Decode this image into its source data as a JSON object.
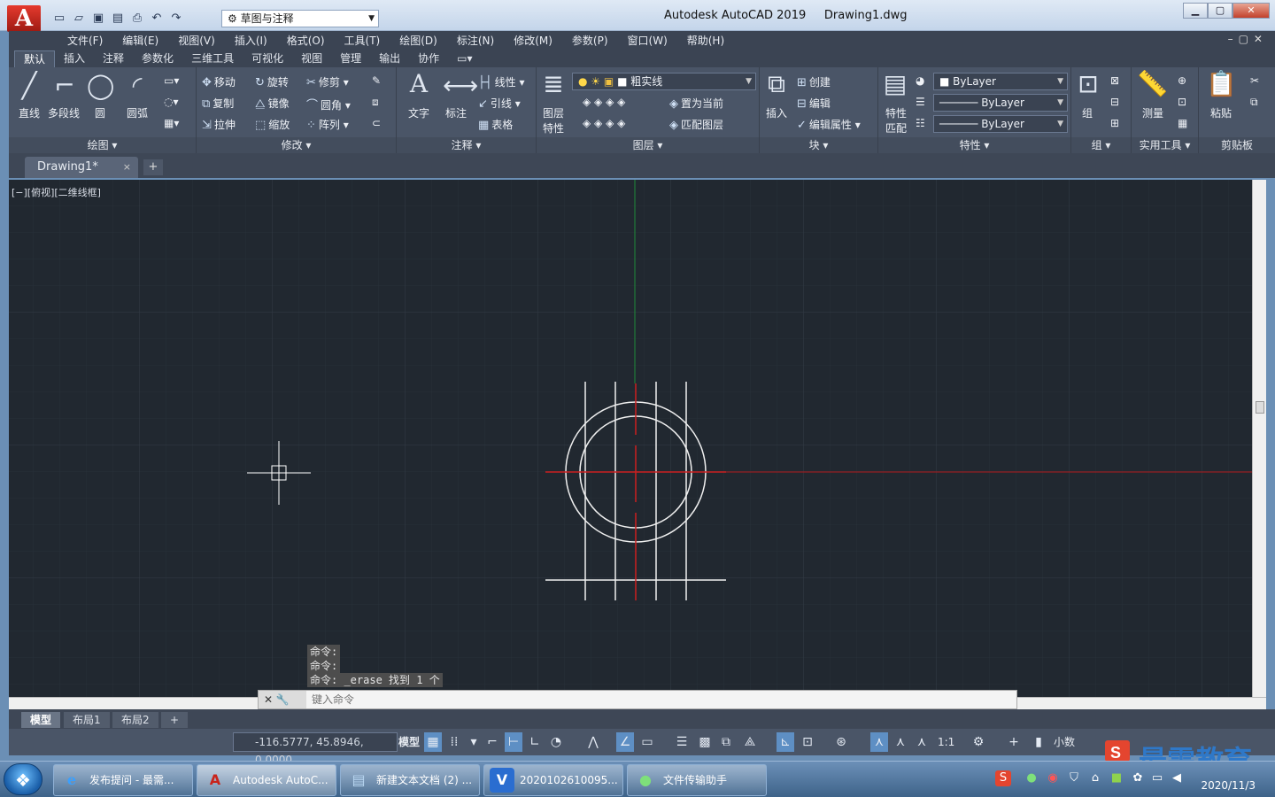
{
  "window": {
    "app_logo": "A",
    "workspace": "草图与注释",
    "app_title": "Autodesk AutoCAD 2019",
    "doc_title": "Drawing1.dwg",
    "title_separator": "     "
  },
  "qat": {
    "icons": [
      "new-icon",
      "open-icon",
      "save-icon",
      "saveas-icon",
      "print-icon",
      "undo-icon",
      "redo-icon"
    ]
  },
  "menu": {
    "items": [
      "文件(F)",
      "编辑(E)",
      "视图(V)",
      "插入(I)",
      "格式(O)",
      "工具(T)",
      "绘图(D)",
      "标注(N)",
      "修改(M)",
      "参数(P)",
      "窗口(W)",
      "帮助(H)"
    ]
  },
  "ribbon_tabs": [
    "默认",
    "插入",
    "注释",
    "参数化",
    "三维工具",
    "可视化",
    "视图",
    "管理",
    "输出",
    "协作"
  ],
  "ribbon": {
    "draw": {
      "title": "绘图",
      "line": "直线",
      "polyline": "多段线",
      "circle": "圆",
      "arc": "圆弧"
    },
    "modify": {
      "title": "修改",
      "move": "移动",
      "rotate": "旋转",
      "trim": "修剪",
      "copy": "复制",
      "mirror": "镜像",
      "fillet": "圆角",
      "stretch": "拉伸",
      "scale": "缩放",
      "array": "阵列"
    },
    "annotation": {
      "title": "注释",
      "text": "文字",
      "dimension": "标注",
      "linear": "线性",
      "leader": "引线",
      "table": "表格"
    },
    "layers": {
      "title": "图层",
      "layer_props_1": "图层",
      "layer_props_2": "特性",
      "current_layer": "粗实线",
      "make_current": "置为当前",
      "match_layer": "匹配图层"
    },
    "block": {
      "title": "块",
      "insert": "插入",
      "create": "创建",
      "edit": "编辑",
      "edit_attr": "编辑属性"
    },
    "properties": {
      "title": "特性",
      "match_1": "特性",
      "match_2": "匹配",
      "color": "ByLayer",
      "lineweight": "ByLayer",
      "linetype": "ByLayer"
    },
    "groups": {
      "title": "组",
      "group": "组"
    },
    "utilities": {
      "title": "实用工具",
      "measure": "测量"
    },
    "clipboard": {
      "title": "剪贴板",
      "paste": "粘贴"
    }
  },
  "doc_tab": {
    "name": "Drawing1*",
    "close": "×",
    "new": "+"
  },
  "viewport": {
    "label": "[−][俯视][二维线框]"
  },
  "command": {
    "history": [
      "命令:",
      "命令:",
      "命令: _erase 找到 1 个"
    ],
    "placeholder": "键入命令"
  },
  "layout_tabs": [
    "模型",
    "布局1",
    "布局2"
  ],
  "status": {
    "coords": "-116.5777, 45.8946, 0.0000",
    "model": "模型",
    "scale": "1:1",
    "units": "小数"
  },
  "taskbar": {
    "tasks": [
      {
        "label": "发布提问 - 最需...",
        "icon": "ie-icon"
      },
      {
        "label": "Autodesk AutoC...",
        "icon": "autocad-icon"
      },
      {
        "label": "新建文本文档 (2) ...",
        "icon": "notepad-icon"
      },
      {
        "label": "2020102610095...",
        "icon": "video-icon"
      },
      {
        "label": "文件传输助手",
        "icon": "wechat-icon"
      }
    ],
    "date": "2020/11/3"
  },
  "brand": {
    "text": "最需教育"
  },
  "colors": {
    "canvas": "#212830",
    "ribbon": "#4a5567",
    "red_axis": "#cc1f1f",
    "green_axis": "#1f8c3a",
    "geometry": "#f0f0f0"
  }
}
